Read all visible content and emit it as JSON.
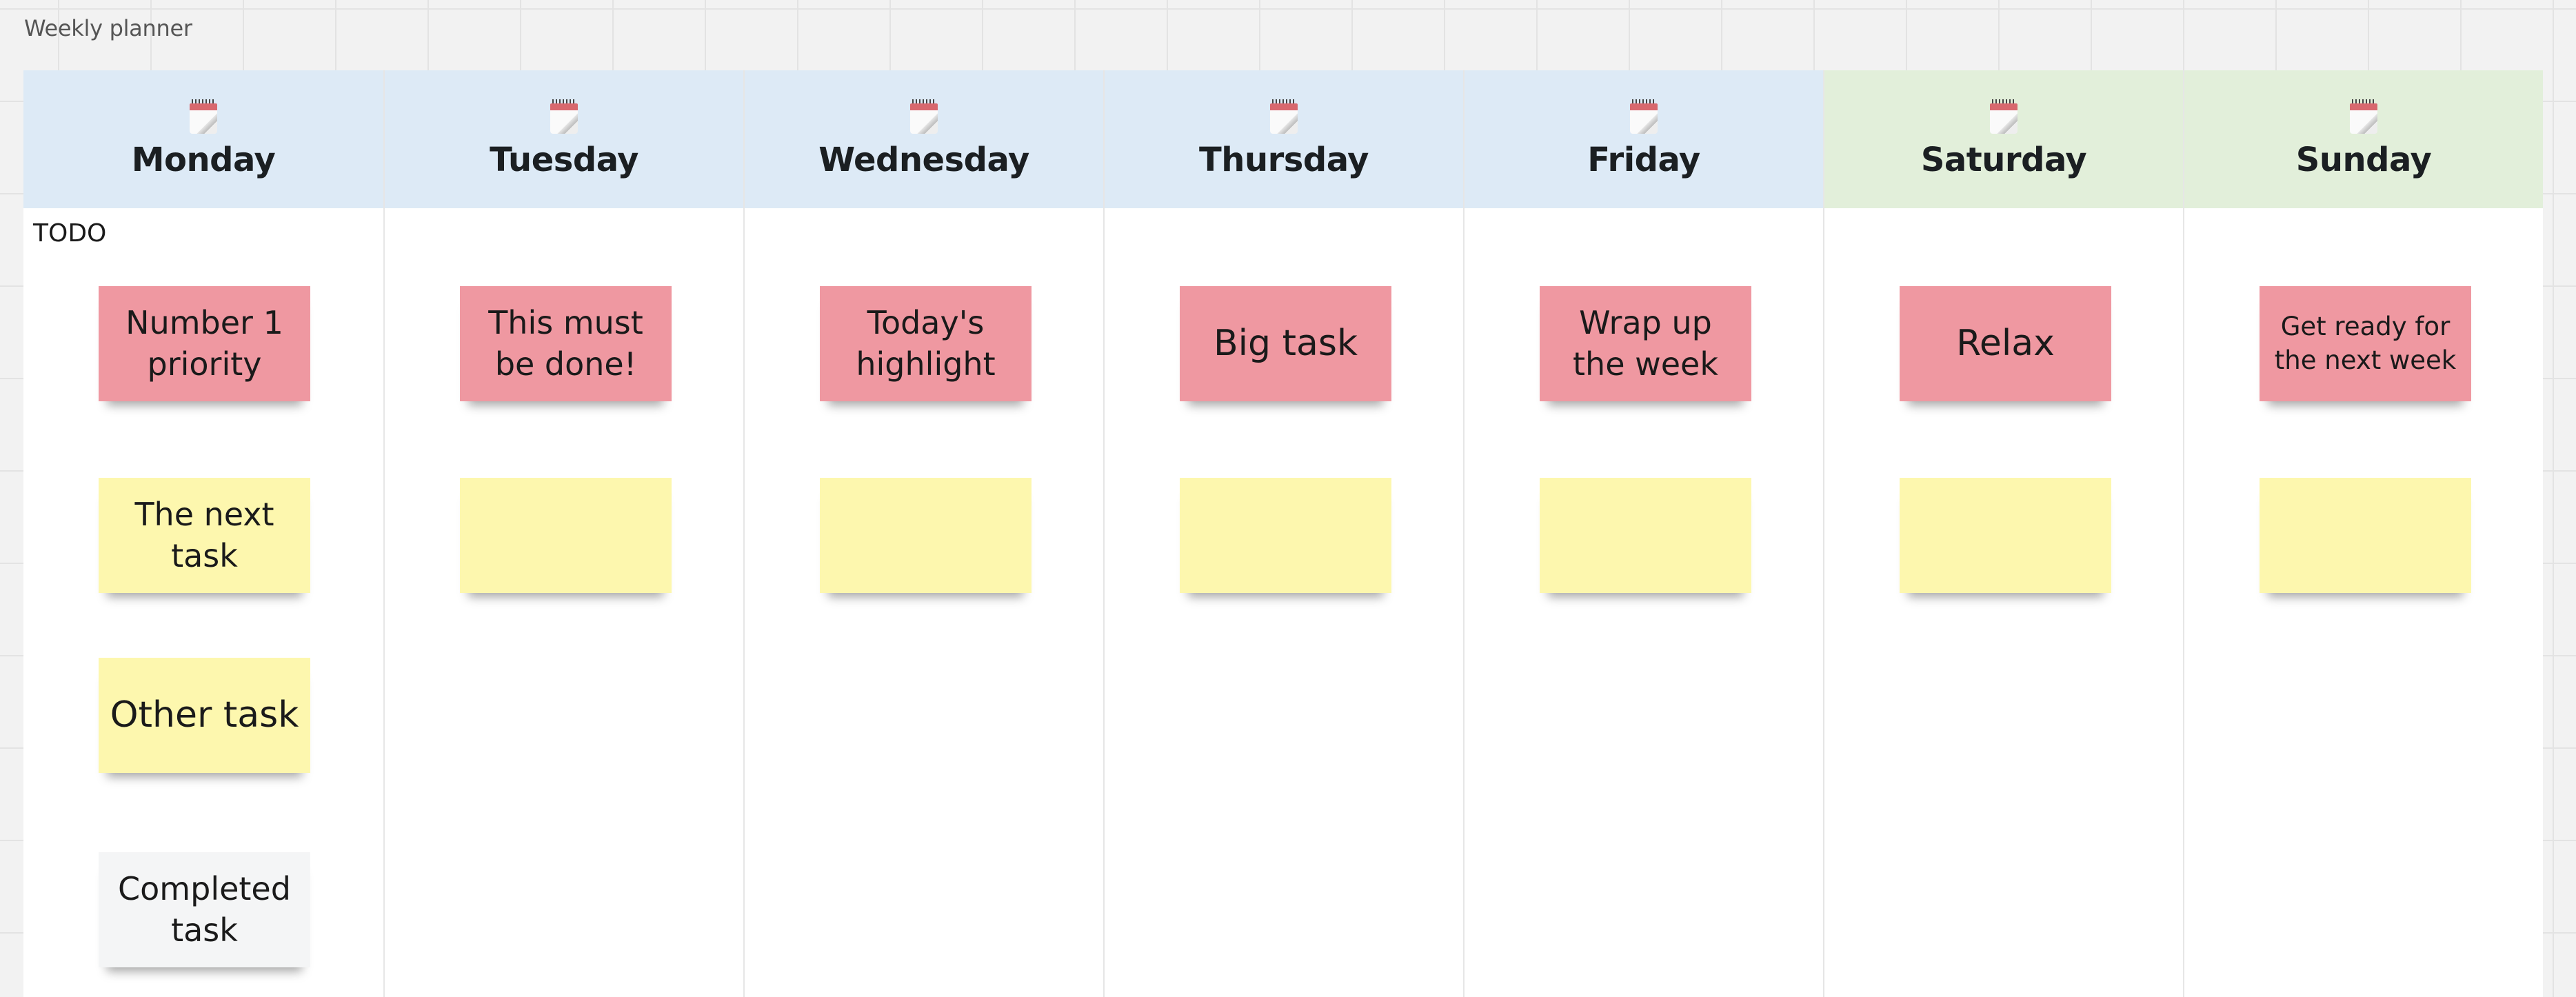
{
  "board": {
    "title": "Weekly planner",
    "todo_label": "TODO",
    "colors": {
      "weekday_header": "#DDEAF6",
      "weekend_header": "#E2EFDA",
      "sticky_pink": "#EF98A1",
      "sticky_yellow": "#FDF7AE",
      "sticky_gray": "#F4F5F6"
    }
  },
  "days": [
    {
      "name": "Monday",
      "icon": "spiral-calendar-icon",
      "type": "weekday",
      "stickies": [
        {
          "text": "Number 1 priority",
          "color": "pink"
        },
        {
          "text": "The next task",
          "color": "yellow"
        },
        {
          "text": "Other task",
          "color": "yellow"
        },
        {
          "text": "Completed task",
          "color": "gray"
        }
      ]
    },
    {
      "name": "Tuesday",
      "icon": "spiral-calendar-icon",
      "type": "weekday",
      "stickies": [
        {
          "text": "This must be done!",
          "color": "pink"
        },
        {
          "text": "",
          "color": "yellow"
        }
      ]
    },
    {
      "name": "Wednesday",
      "icon": "spiral-calendar-icon",
      "type": "weekday",
      "stickies": [
        {
          "text": "Today's highlight",
          "color": "pink"
        },
        {
          "text": "",
          "color": "yellow"
        }
      ]
    },
    {
      "name": "Thursday",
      "icon": "spiral-calendar-icon",
      "type": "weekday",
      "stickies": [
        {
          "text": "Big task",
          "color": "pink"
        },
        {
          "text": "",
          "color": "yellow"
        }
      ]
    },
    {
      "name": "Friday",
      "icon": "spiral-calendar-icon",
      "type": "weekday",
      "stickies": [
        {
          "text": "Wrap up the week",
          "color": "pink"
        },
        {
          "text": "",
          "color": "yellow"
        }
      ]
    },
    {
      "name": "Saturday",
      "icon": "spiral-calendar-icon",
      "type": "weekend",
      "stickies": [
        {
          "text": "Relax",
          "color": "pink"
        },
        {
          "text": "",
          "color": "yellow"
        }
      ]
    },
    {
      "name": "Sunday",
      "icon": "spiral-calendar-icon",
      "type": "weekend",
      "stickies": [
        {
          "text": "Get ready for the next week",
          "color": "pink"
        },
        {
          "text": "",
          "color": "yellow"
        }
      ]
    }
  ]
}
